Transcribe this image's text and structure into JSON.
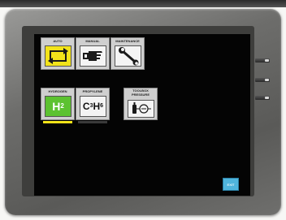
{
  "panel": {
    "buttons_row1": [
      {
        "label": "AUTO",
        "icon": "auto-cycle-icon"
      },
      {
        "label": "MANUAL",
        "icon": "hand-pointer-icon"
      },
      {
        "label": "MAINTENANCE",
        "icon": "wrench-icon"
      }
    ],
    "buttons_row2": [
      {
        "label": "HYDROGEN",
        "symbol": "H",
        "subscript": "2"
      },
      {
        "label": "PROPYLENE",
        "symbol_parts": [
          "C",
          "3",
          "H",
          "6"
        ]
      }
    ],
    "pressure_button": {
      "label_line1": "TOOLBOX",
      "label_line2": "PRESSURE",
      "icon": "pressure-gauge-icon"
    },
    "exit_label": "EXIT"
  },
  "colors": {
    "auto_icon_bg": "#f2e31a",
    "hydrogen_bg": "#5cc230",
    "hydrogen_indicator": "#f2e31a",
    "propylene_indicator": "#3a3a3a",
    "exit_bg": "#4fb4dc",
    "screen_bg": "#040404"
  }
}
